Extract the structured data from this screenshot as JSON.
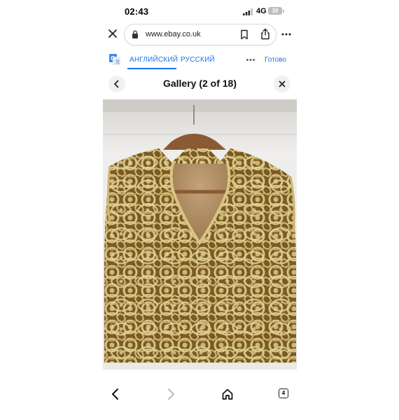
{
  "status_bar": {
    "time": "02:43",
    "network": "4G",
    "battery": "39",
    "icons": [
      "signal-icon",
      "battery-icon"
    ]
  },
  "browser": {
    "url": "www.ebay.co.uk",
    "icons": [
      "close-icon",
      "lock-icon",
      "bookmark-icon",
      "share-icon",
      "more-icon"
    ]
  },
  "translate_bar": {
    "language_from": "АНГЛИЙСКИЙ",
    "language_to": "РУССКИЙ",
    "done": "Готово",
    "accent": "#1a73e8",
    "icons": [
      "google-translate-icon",
      "more-icon"
    ]
  },
  "gallery": {
    "title": "Gallery (2 of 18)",
    "icons": [
      "chevron-left-icon",
      "close-icon"
    ],
    "image_alt": "lace-top-photo"
  },
  "bottom_nav": {
    "tabs_count": "4",
    "icons": [
      "back-icon",
      "forward-icon",
      "home-icon",
      "tabs-icon"
    ]
  }
}
